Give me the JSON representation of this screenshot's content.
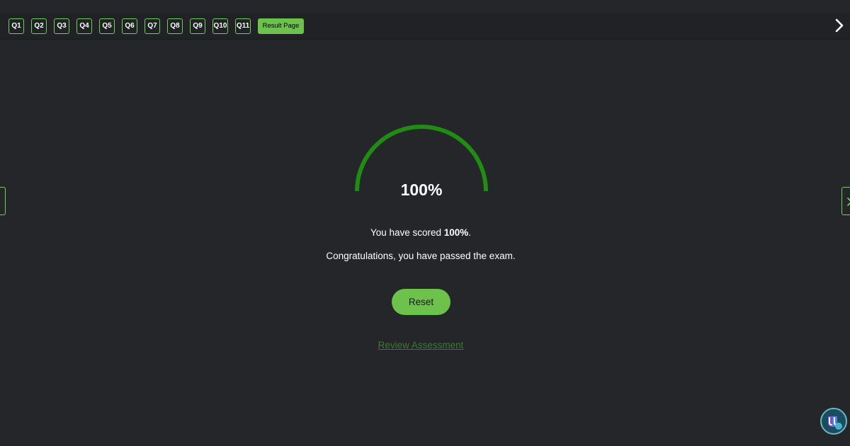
{
  "nav": {
    "questions": [
      "Q1",
      "Q2",
      "Q3",
      "Q4",
      "Q5",
      "Q6",
      "Q7",
      "Q8",
      "Q9",
      "Q10",
      "Q11"
    ],
    "result_label": "Result Page",
    "next_icon": "chevron-right-icon"
  },
  "result": {
    "score_percent": 100,
    "score_display": "100%",
    "scored_prefix": "You have scored ",
    "scored_value": "100%",
    "scored_suffix": ".",
    "message": "Congratulations, you have passed the exam.",
    "reset_label": "Reset",
    "review_label": "Review Assessment"
  },
  "colors": {
    "background": "#24262a",
    "accent": "#6cc24a",
    "gauge": "#1f8c12",
    "link": "#3c7a2c"
  }
}
